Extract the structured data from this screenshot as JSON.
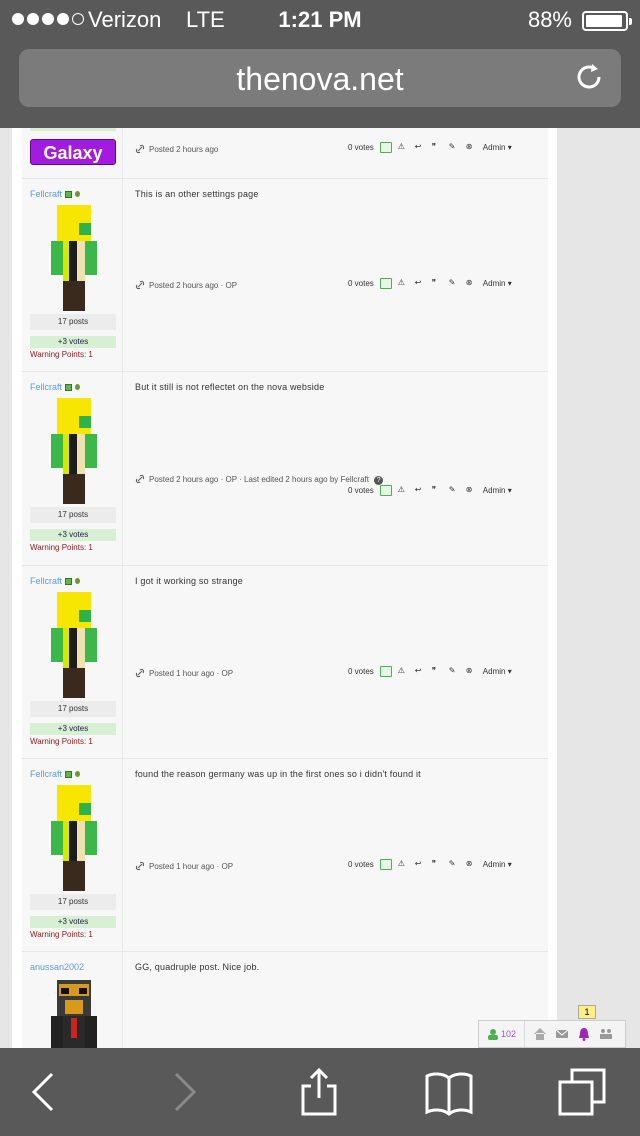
{
  "status_bar": {
    "carrier": "Verizon",
    "network": "LTE",
    "time": "1:21 PM",
    "battery_percent": "88%",
    "battery_level": 0.88,
    "signal_bars": 4
  },
  "browser": {
    "url": "thenova.net"
  },
  "posts": [
    {
      "author": "",
      "rank_badge": "Galaxy",
      "body": "",
      "meta": "Posted 2 hours ago",
      "votes": "0 votes",
      "admin": "Admin"
    },
    {
      "author": "Fellcraft",
      "post_count": "17 posts",
      "votes_summary": "+3 votes",
      "warning": "Warning Points: 1",
      "body": "This is an other settings page",
      "meta": "Posted 2 hours ago · OP",
      "votes": "0 votes",
      "admin": "Admin"
    },
    {
      "author": "Fellcraft",
      "post_count": "17 posts",
      "votes_summary": "+3 votes",
      "warning": "Warning Points: 1",
      "body": "But it still is not reflectet on the nova webside",
      "meta": "Posted 2 hours ago · OP · Last edited 2 hours ago by Fellcraft",
      "votes": "0 votes",
      "admin": "Admin"
    },
    {
      "author": "Fellcraft",
      "post_count": "17 posts",
      "votes_summary": "+3 votes",
      "warning": "Warning Points: 1",
      "body": "I got it working so strange",
      "meta": "Posted 1 hour ago · OP",
      "votes": "0 votes",
      "admin": "Admin"
    },
    {
      "author": "Fellcraft",
      "post_count": "17 posts",
      "votes_summary": "+3 votes",
      "warning": "Warning Points: 1",
      "body": "found the reason germany was up in the first ones so i didn't found it",
      "meta": "Posted 1 hour ago · OP",
      "votes": "0 votes",
      "admin": "Admin"
    },
    {
      "author": "anussan2002",
      "body": "GG, quadruple post. Nice job."
    }
  ],
  "floating_bar": {
    "online_count": "102",
    "notification_badge": "1"
  },
  "colors": {
    "chrome": "#595959",
    "galaxy_badge": "#a21ce0",
    "username": "#5b9bd5",
    "warning": "#8b1a1a"
  }
}
